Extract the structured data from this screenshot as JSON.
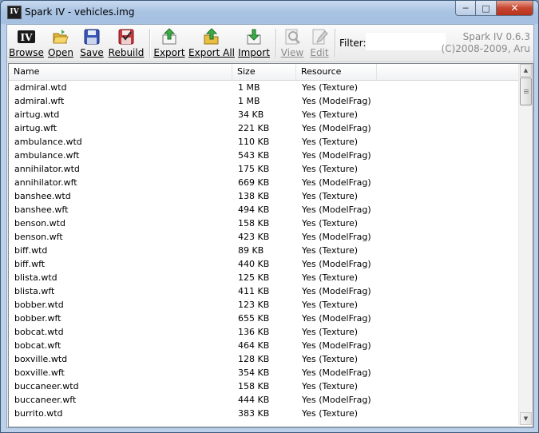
{
  "window": {
    "title": "Spark IV - vehicles.img",
    "app_icon_text": "IV"
  },
  "toolbar": {
    "buttons": [
      {
        "label": "Browse",
        "icon": "iv-logo-icon"
      },
      {
        "label": "Open",
        "icon": "open-folder-icon"
      },
      {
        "label": "Save",
        "icon": "floppy-disk-icon"
      },
      {
        "label": "Rebuild",
        "icon": "rebuild-icon"
      },
      {
        "label": "Export",
        "icon": "export-icon"
      },
      {
        "label": "Export All",
        "icon": "export-all-icon"
      },
      {
        "label": "Import",
        "icon": "import-icon"
      },
      {
        "label": "View",
        "icon": "magnifier-icon"
      },
      {
        "label": "Edit",
        "icon": "edit-icon"
      }
    ],
    "filter_label": "Filter:",
    "filter_value": "",
    "brand_line1": "Spark IV 0.6.3",
    "brand_line2": "(C)2008-2009, Aru"
  },
  "columns": [
    "Name",
    "Size",
    "Resource"
  ],
  "rows": [
    {
      "name": "admiral.wtd",
      "size": "1 MB",
      "resource": "Yes (Texture)"
    },
    {
      "name": "admiral.wft",
      "size": "1 MB",
      "resource": "Yes (ModelFrag)"
    },
    {
      "name": "airtug.wtd",
      "size": "34 KB",
      "resource": "Yes (Texture)"
    },
    {
      "name": "airtug.wft",
      "size": "221 KB",
      "resource": "Yes (ModelFrag)"
    },
    {
      "name": "ambulance.wtd",
      "size": "110 KB",
      "resource": "Yes (Texture)"
    },
    {
      "name": "ambulance.wft",
      "size": "543 KB",
      "resource": "Yes (ModelFrag)"
    },
    {
      "name": "annihilator.wtd",
      "size": "175 KB",
      "resource": "Yes (Texture)"
    },
    {
      "name": "annihilator.wft",
      "size": "669 KB",
      "resource": "Yes (ModelFrag)"
    },
    {
      "name": "banshee.wtd",
      "size": "138 KB",
      "resource": "Yes (Texture)"
    },
    {
      "name": "banshee.wft",
      "size": "494 KB",
      "resource": "Yes (ModelFrag)"
    },
    {
      "name": "benson.wtd",
      "size": "158 KB",
      "resource": "Yes (Texture)"
    },
    {
      "name": "benson.wft",
      "size": "423 KB",
      "resource": "Yes (ModelFrag)"
    },
    {
      "name": "biff.wtd",
      "size": "89 KB",
      "resource": "Yes (Texture)"
    },
    {
      "name": "biff.wft",
      "size": "440 KB",
      "resource": "Yes (ModelFrag)"
    },
    {
      "name": "blista.wtd",
      "size": "125 KB",
      "resource": "Yes (Texture)"
    },
    {
      "name": "blista.wft",
      "size": "411 KB",
      "resource": "Yes (ModelFrag)"
    },
    {
      "name": "bobber.wtd",
      "size": "123 KB",
      "resource": "Yes (Texture)"
    },
    {
      "name": "bobber.wft",
      "size": "655 KB",
      "resource": "Yes (ModelFrag)"
    },
    {
      "name": "bobcat.wtd",
      "size": "136 KB",
      "resource": "Yes (Texture)"
    },
    {
      "name": "bobcat.wft",
      "size": "464 KB",
      "resource": "Yes (ModelFrag)"
    },
    {
      "name": "boxville.wtd",
      "size": "128 KB",
      "resource": "Yes (Texture)"
    },
    {
      "name": "boxville.wft",
      "size": "354 KB",
      "resource": "Yes (ModelFrag)"
    },
    {
      "name": "buccaneer.wtd",
      "size": "158 KB",
      "resource": "Yes (Texture)"
    },
    {
      "name": "buccaneer.wft",
      "size": "444 KB",
      "resource": "Yes (ModelFrag)"
    },
    {
      "name": "burrito.wtd",
      "size": "383 KB",
      "resource": "Yes (Texture)"
    }
  ]
}
